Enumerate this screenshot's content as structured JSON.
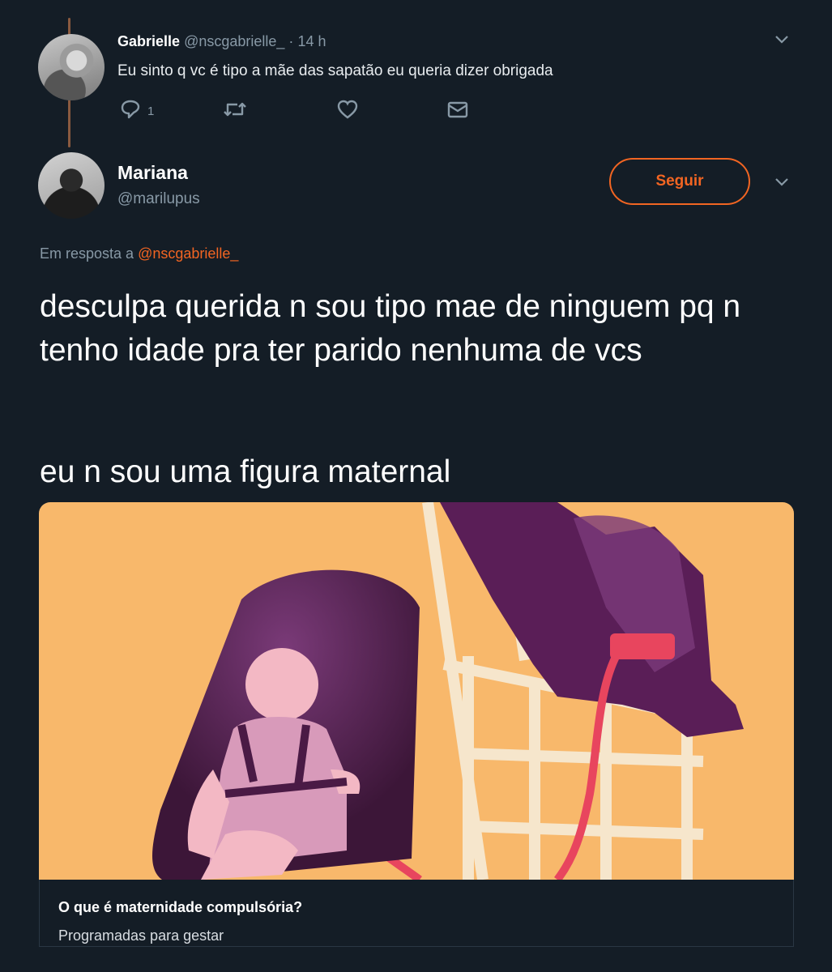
{
  "reply_tweet": {
    "name": "Gabrielle",
    "handle": "@nscgabrielle_",
    "separator": "·",
    "time": "14 h",
    "text": "Eu sinto q vc é tipo a mãe das sapatão eu queria dizer obrigada",
    "reply_count": "1",
    "icons": [
      "reply-icon",
      "retweet-icon",
      "like-icon",
      "message-icon",
      "chevron-down-icon"
    ]
  },
  "main_tweet": {
    "name": "Mariana",
    "handle": "@marilupus",
    "follow_label": "Seguir",
    "reply_prefix": "Em resposta a",
    "reply_mention": "@nscgabrielle_",
    "text_1": "desculpa querida n sou tipo mae de ninguem pq n tenho idade pra ter parido nenhuma de vcs",
    "text_2": "eu n sou uma figura maternal"
  },
  "link_card": {
    "title": "O que é maternidade compulsória?",
    "description": "Programadas para gestar"
  },
  "colors": {
    "background": "#141d26",
    "accent": "#f26522",
    "muted": "#8899a6",
    "card_bg": "#f8b86b"
  }
}
